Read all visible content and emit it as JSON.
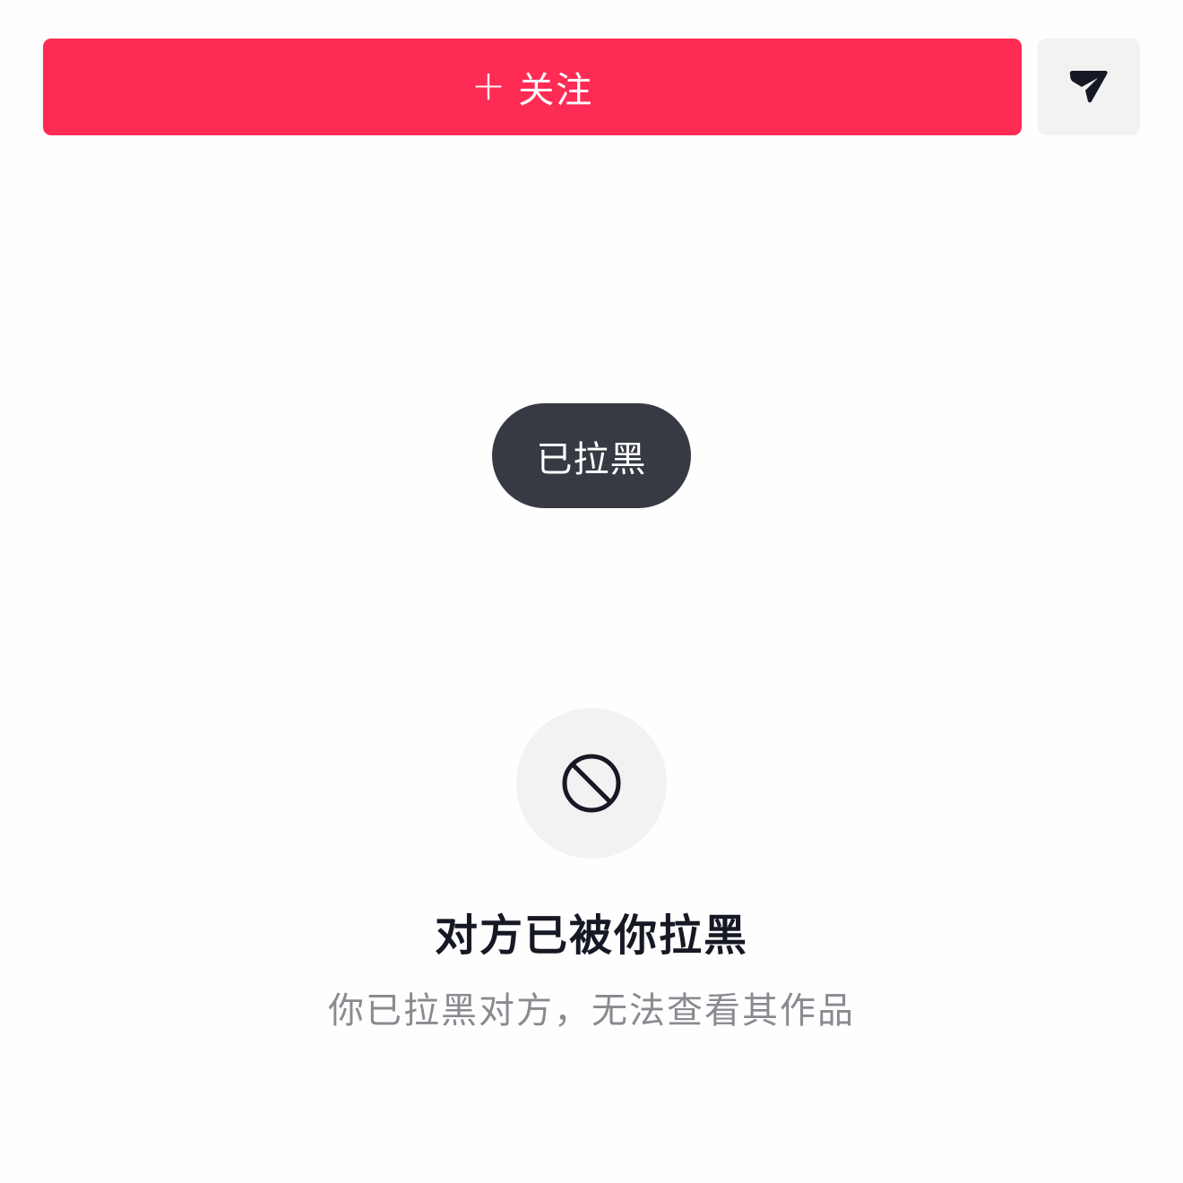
{
  "profile_actions": {
    "follow_plus": "+",
    "follow_label": "关注",
    "share_icon": "send-arrow-icon"
  },
  "toast": {
    "text": "已拉黑"
  },
  "blocked_state": {
    "icon": "block-icon",
    "title": "对方已被你拉黑",
    "subtitle": "你已拉黑对方，无法查看其作品"
  },
  "colors": {
    "follow_button": "#fe2c55",
    "toast_background": "#373a43",
    "icon_background": "#f2f2f3",
    "title_text": "#161823",
    "subtitle_text": "#8a8b91"
  }
}
